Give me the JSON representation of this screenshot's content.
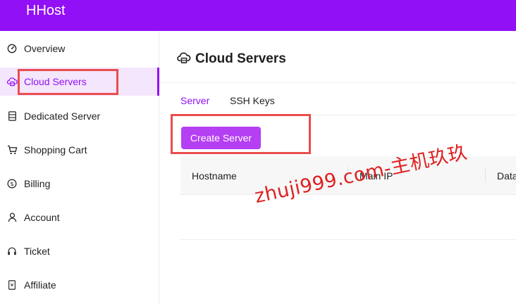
{
  "app": {
    "brand": "HHost"
  },
  "colors": {
    "accent": "#9210f6",
    "button": "#b43ff3",
    "annotation": "#ea4d4d",
    "watermark": "#e02020"
  },
  "sidebar": {
    "items": [
      {
        "label": "Overview",
        "icon": "dashboard-gauge-icon",
        "active": false
      },
      {
        "label": "Cloud Servers",
        "icon": "cloud-server-icon",
        "active": true
      },
      {
        "label": "Dedicated Server",
        "icon": "server-rack-icon",
        "active": false
      },
      {
        "label": "Shopping Cart",
        "icon": "shopping-cart-icon",
        "active": false
      },
      {
        "label": "Billing",
        "icon": "dollar-circle-icon",
        "active": false
      },
      {
        "label": "Account",
        "icon": "user-icon",
        "active": false
      },
      {
        "label": "Ticket",
        "icon": "headset-icon",
        "active": false
      },
      {
        "label": "Affiliate",
        "icon": "affiliate-document-icon",
        "active": false
      }
    ]
  },
  "main": {
    "title": "Cloud Servers",
    "title_icon": "cloud-server-icon",
    "tabs": [
      {
        "label": "Server",
        "active": true
      },
      {
        "label": "SSH Keys",
        "active": false
      }
    ],
    "create_button": "Create Server",
    "table": {
      "columns": [
        "Hostname",
        "Main IP",
        "Data"
      ],
      "rows": []
    }
  },
  "watermark": "zhuji999.com-主机玖玖"
}
